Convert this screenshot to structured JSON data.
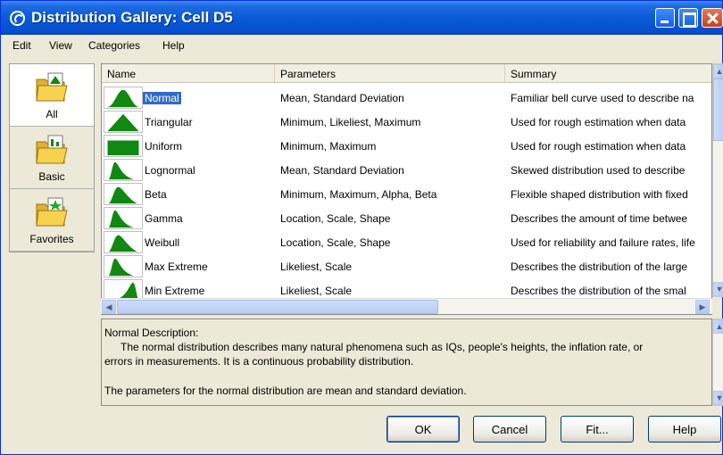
{
  "window": {
    "title": "Distribution Gallery: Cell D5"
  },
  "menu": [
    "Edit",
    "View",
    "Categories",
    "Help"
  ],
  "categories": [
    {
      "label": "All",
      "selected": true
    },
    {
      "label": "Basic",
      "selected": false
    },
    {
      "label": "Favorites",
      "selected": false
    }
  ],
  "table": {
    "columns": [
      "Name",
      "Parameters",
      "Summary"
    ],
    "rows": [
      {
        "name": "Normal",
        "params": "Mean, Standard Deviation",
        "summary": "Familiar bell curve used to describe na",
        "shape": "normal-curve-icon",
        "selected": true
      },
      {
        "name": "Triangular",
        "params": "Minimum, Likeliest, Maximum",
        "summary": "Used for rough estimation when data",
        "shape": "triangle-icon"
      },
      {
        "name": "Uniform",
        "params": "Minimum, Maximum",
        "summary": "Used for rough estimation when data",
        "shape": "uniform-icon"
      },
      {
        "name": "Lognormal",
        "params": "Mean, Standard Deviation",
        "summary": "Skewed distribution used to describe",
        "shape": "right-skew-icon"
      },
      {
        "name": "Beta",
        "params": "Minimum, Maximum, Alpha, Beta",
        "summary": "Flexible shaped distribution with fixed",
        "shape": "beta-icon"
      },
      {
        "name": "Gamma",
        "params": "Location, Scale, Shape",
        "summary": "Describes the amount of time betwee",
        "shape": "right-skew-icon"
      },
      {
        "name": "Weibull",
        "params": "Location, Scale, Shape",
        "summary": "Used for reliability and failure rates, life",
        "shape": "beta-icon"
      },
      {
        "name": "Max Extreme",
        "params": "Likeliest, Scale",
        "summary": "Describes the distribution of the large",
        "shape": "right-skew-icon"
      },
      {
        "name": "Min Extreme",
        "params": "Likeliest, Scale",
        "summary": "Describes the distribution of the smal",
        "shape": "left-skew-icon"
      }
    ]
  },
  "description": {
    "heading": "Normal Description:",
    "line1": "The normal distribution describes many natural phenomena such as IQs, people's heights, the inflation rate, or",
    "line2": "errors in measurements. It is a continuous probability distribution.",
    "line3": "The parameters for the normal distribution are mean and standard deviation."
  },
  "buttons": {
    "ok": "OK",
    "cancel": "Cancel",
    "fit": "Fit...",
    "help": "Help"
  },
  "colors": {
    "shape_fill": "#118811",
    "selection": "#316ac5",
    "title_bar": "#0a5bd8"
  }
}
